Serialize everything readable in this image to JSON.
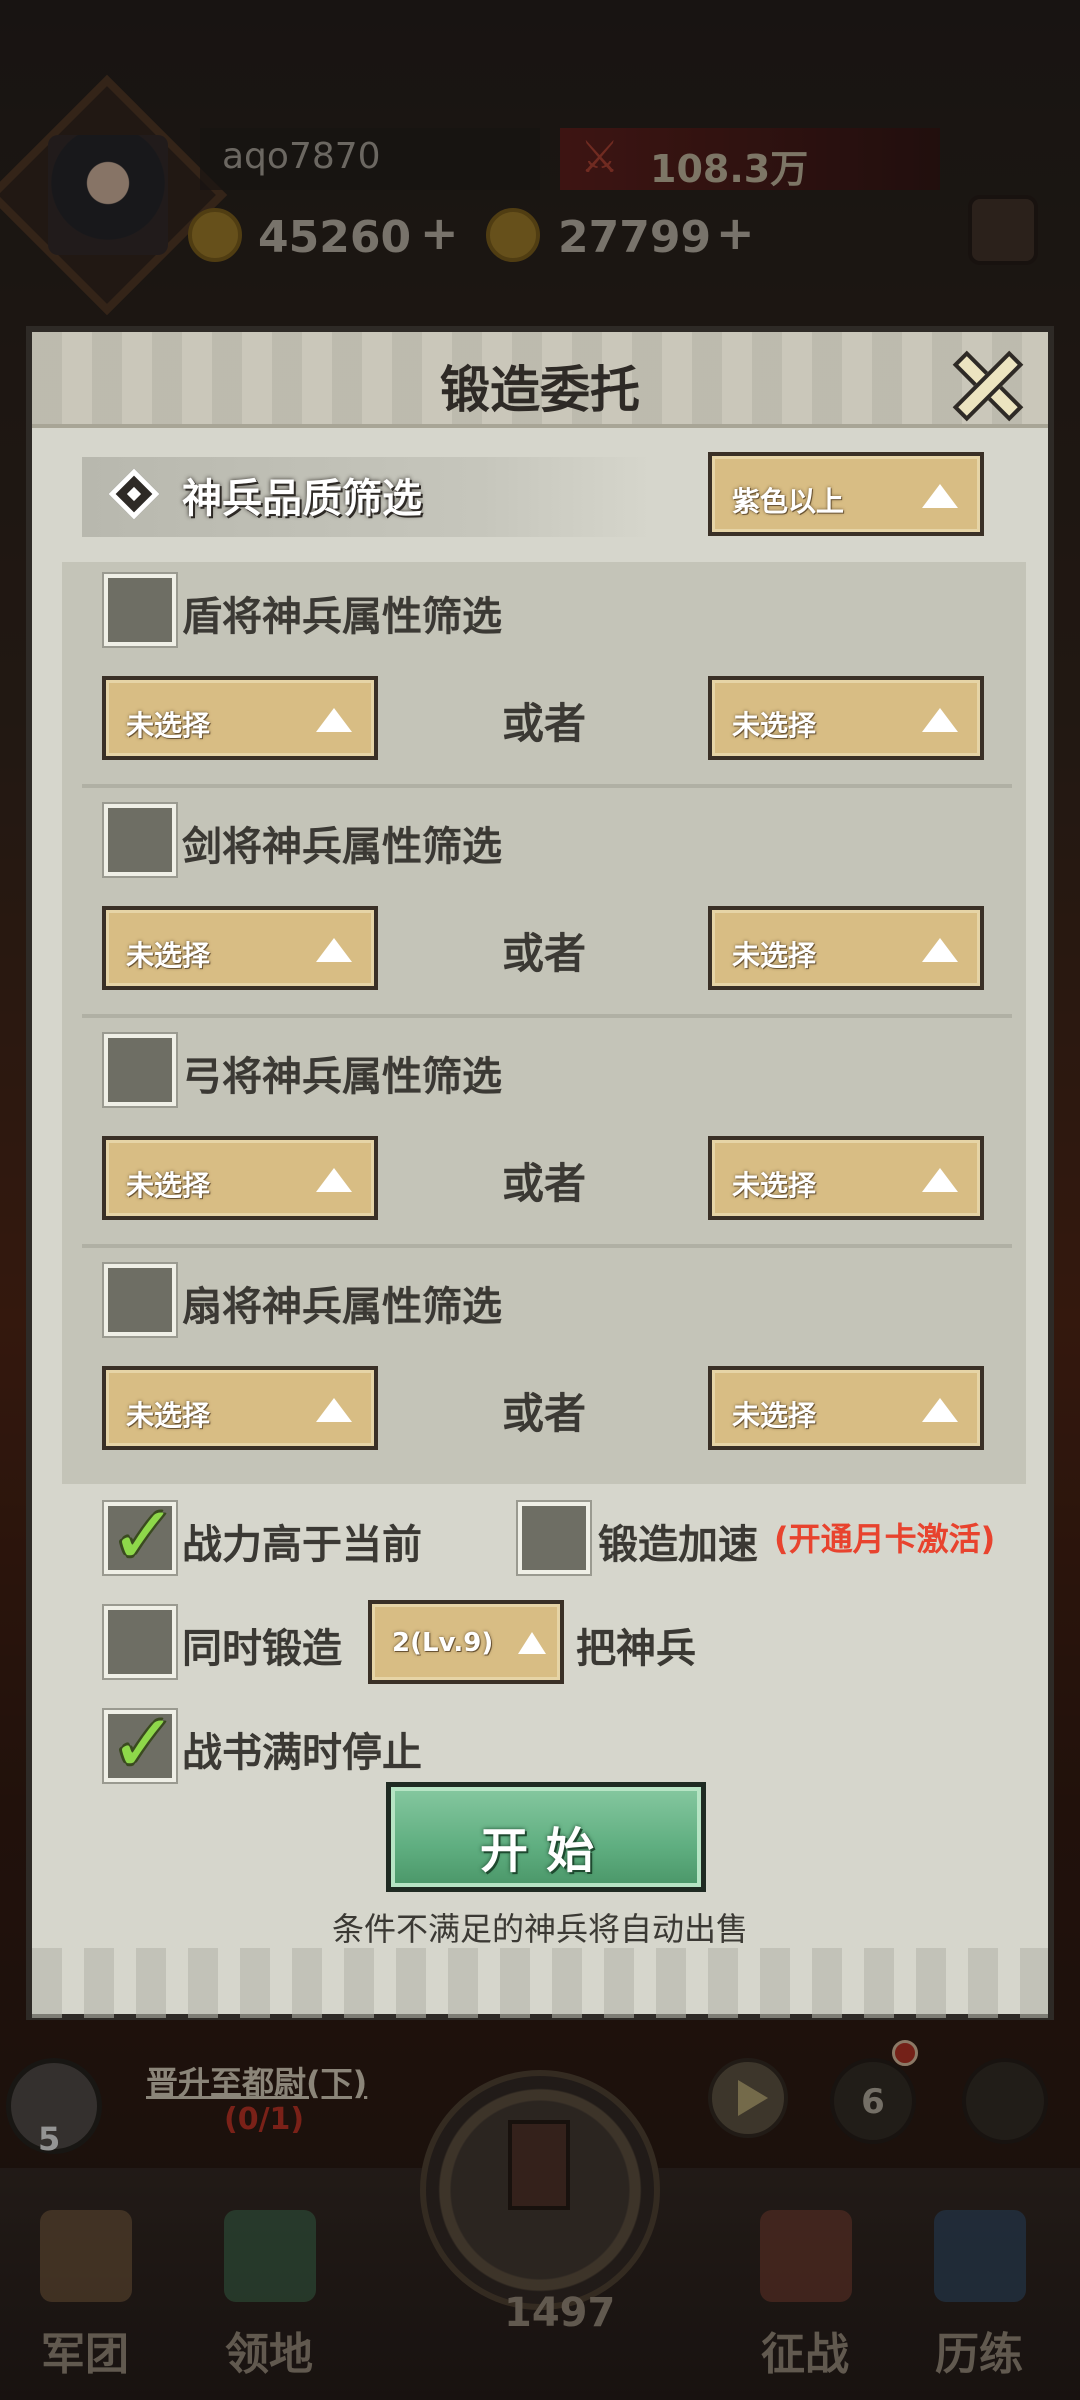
{
  "hud": {
    "username": "aqo7870",
    "power": "108.3万",
    "ingots": "45260",
    "coins": "27799",
    "plus": "+"
  },
  "dialog": {
    "title": "锻造委托",
    "quality_filter_label": "神兵品质筛选",
    "quality_filter_value": "紫色以上",
    "filters": [
      {
        "label": "盾将神兵属性筛选",
        "left": "未选择",
        "or": "或者",
        "right": "未选择"
      },
      {
        "label": "剑将神兵属性筛选",
        "left": "未选择",
        "or": "或者",
        "right": "未选择"
      },
      {
        "label": "弓将神兵属性筛选",
        "left": "未选择",
        "or": "或者",
        "right": "未选择"
      },
      {
        "label": "扇将神兵属性筛选",
        "left": "未选择",
        "or": "或者",
        "right": "未选择"
      }
    ],
    "opt_power_higher": "战力高于当前",
    "opt_power_higher_checked": true,
    "opt_speedup": "锻造加速",
    "opt_speedup_note": "(开通月卡激活)",
    "opt_speedup_checked": false,
    "opt_simultaneous": "同时锻造",
    "opt_simultaneous_value": "2(Lv.9)",
    "opt_simultaneous_suffix": "把神兵",
    "opt_simultaneous_checked": false,
    "opt_stop_full": "战书满时停止",
    "opt_stop_full_checked": true,
    "start_label": "开始",
    "hint": "条件不满足的神兵将自动出售"
  },
  "quest": {
    "count": "5",
    "title": "晋升至都尉(下)",
    "progress": "(0/1)"
  },
  "bottom": {
    "badge_six": "6",
    "forge_count": "1497",
    "nav": [
      "军团",
      "领地",
      "征战",
      "历练"
    ]
  },
  "colors": {
    "dialog_bg": "#d6d6cc",
    "dropdown": "#d8bd84",
    "start_green": "#5fae80",
    "note_red": "#e8432e",
    "check_green": "#8ed84a"
  }
}
